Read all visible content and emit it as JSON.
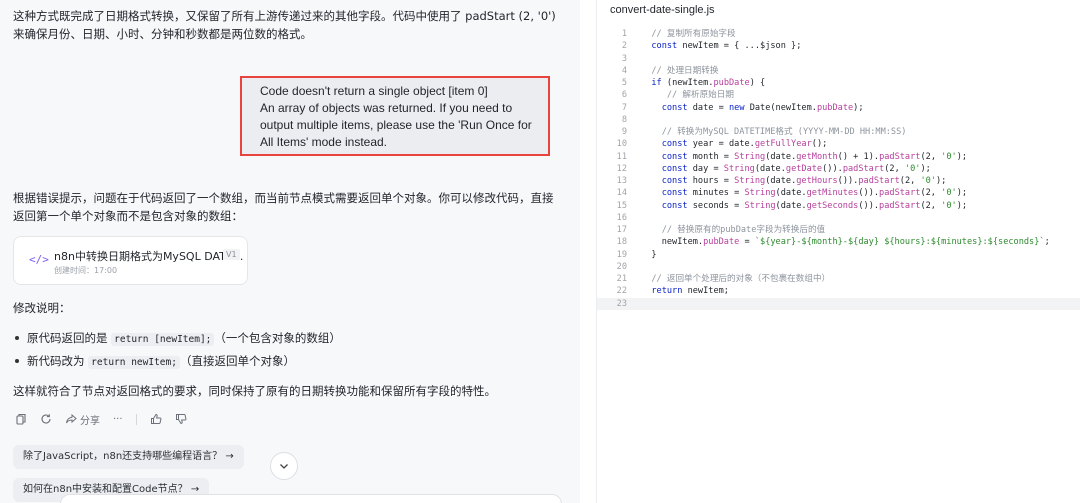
{
  "chat": {
    "intro_text": "这种方式既完成了日期格式转换，又保留了所有上游传递过来的其他字段。代码中使用了 padStart (2, '0') 来确保月份、日期、小时、分钟和秒数都是两位数的格式。",
    "user_message": {
      "line1": "Code doesn't return a single object [item 0]",
      "line2": "An array of objects was returned. If you need to",
      "line3": "output multiple items, please use the 'Run Once for",
      "line4": "All Items' mode instead."
    },
    "answer_text": "根据错误提示，问题在于代码返回了一个数组，而当前节点模式需要返回单个对象。你可以修改代码，直接返回第一个单个对象而不是包含对象的数组：",
    "artifact_card": {
      "icon": "code-icon",
      "title": "n8n中转换日期格式为MySQL DATE...",
      "version": "V1",
      "created": "创建时间：17:00"
    },
    "changes_heading": "修改说明：",
    "bullet1": {
      "prefix": "原代码返回的是 ",
      "code": "return [newItem];",
      "suffix": "（一个包含对象的数组）"
    },
    "bullet2": {
      "prefix": "新代码改为 ",
      "code": "return newItem;",
      "suffix": "（直接返回单个对象）"
    },
    "summary_text": "这样就符合了节点对返回格式的要求，同时保持了原有的日期转换功能和保留所有字段的特性。",
    "actions": {
      "share_label": "分享",
      "more_label": "···"
    },
    "suggestions": [
      "除了JavaScript，n8n还支持哪些编程语言？ →",
      "如何在n8n中安装和配置Code节点？ →"
    ]
  },
  "editor": {
    "filename": "convert-date-single.js",
    "active_line": 23,
    "lines": [
      {
        "n": "1",
        "tokens": [
          {
            "t": "  // 复制所有原始字段",
            "c": "com"
          }
        ]
      },
      {
        "n": "2",
        "tokens": [
          {
            "t": "  ",
            "c": "pl"
          },
          {
            "t": "const",
            "c": "kw"
          },
          {
            "t": " newItem = { ...$json };",
            "c": "pl"
          }
        ]
      },
      {
        "n": "3",
        "tokens": []
      },
      {
        "n": "4",
        "tokens": [
          {
            "t": "  // 处理日期转换",
            "c": "com"
          }
        ]
      },
      {
        "n": "5",
        "tokens": [
          {
            "t": "  ",
            "c": "pl"
          },
          {
            "t": "if",
            "c": "kw"
          },
          {
            "t": " (newItem.",
            "c": "pl"
          },
          {
            "t": "pubDate",
            "c": "fn"
          },
          {
            "t": ") {",
            "c": "pl"
          }
        ]
      },
      {
        "n": "6",
        "tokens": [
          {
            "t": "     // 解析原始日期",
            "c": "com"
          }
        ]
      },
      {
        "n": "7",
        "tokens": [
          {
            "t": "    ",
            "c": "pl"
          },
          {
            "t": "const",
            "c": "kw"
          },
          {
            "t": " date = ",
            "c": "pl"
          },
          {
            "t": "new",
            "c": "kw"
          },
          {
            "t": " Date(newItem.",
            "c": "pl"
          },
          {
            "t": "pubDate",
            "c": "fn"
          },
          {
            "t": ");",
            "c": "pl"
          }
        ]
      },
      {
        "n": "8",
        "tokens": []
      },
      {
        "n": "9",
        "tokens": [
          {
            "t": "    // 转换为MySQL DATETIME格式 (YYYY-MM-DD HH:MM:SS)",
            "c": "com"
          }
        ]
      },
      {
        "n": "10",
        "tokens": [
          {
            "t": "    ",
            "c": "pl"
          },
          {
            "t": "const",
            "c": "kw"
          },
          {
            "t": " year = date.",
            "c": "pl"
          },
          {
            "t": "getFullYear",
            "c": "fn"
          },
          {
            "t": "();",
            "c": "pl"
          }
        ]
      },
      {
        "n": "11",
        "tokens": [
          {
            "t": "    ",
            "c": "pl"
          },
          {
            "t": "const",
            "c": "kw"
          },
          {
            "t": " month = ",
            "c": "pl"
          },
          {
            "t": "String",
            "c": "fn"
          },
          {
            "t": "(date.",
            "c": "pl"
          },
          {
            "t": "getMonth",
            "c": "fn"
          },
          {
            "t": "() + 1).",
            "c": "pl"
          },
          {
            "t": "padStart",
            "c": "fn"
          },
          {
            "t": "(2, ",
            "c": "pl"
          },
          {
            "t": "'0'",
            "c": "str"
          },
          {
            "t": ");",
            "c": "pl"
          }
        ]
      },
      {
        "n": "12",
        "tokens": [
          {
            "t": "    ",
            "c": "pl"
          },
          {
            "t": "const",
            "c": "kw"
          },
          {
            "t": " day = ",
            "c": "pl"
          },
          {
            "t": "String",
            "c": "fn"
          },
          {
            "t": "(date.",
            "c": "pl"
          },
          {
            "t": "getDate",
            "c": "fn"
          },
          {
            "t": "()).",
            "c": "pl"
          },
          {
            "t": "padStart",
            "c": "fn"
          },
          {
            "t": "(2, ",
            "c": "pl"
          },
          {
            "t": "'0'",
            "c": "str"
          },
          {
            "t": ");",
            "c": "pl"
          }
        ]
      },
      {
        "n": "13",
        "tokens": [
          {
            "t": "    ",
            "c": "pl"
          },
          {
            "t": "const",
            "c": "kw"
          },
          {
            "t": " hours = ",
            "c": "pl"
          },
          {
            "t": "String",
            "c": "fn"
          },
          {
            "t": "(date.",
            "c": "pl"
          },
          {
            "t": "getHours",
            "c": "fn"
          },
          {
            "t": "()).",
            "c": "pl"
          },
          {
            "t": "padStart",
            "c": "fn"
          },
          {
            "t": "(2, ",
            "c": "pl"
          },
          {
            "t": "'0'",
            "c": "str"
          },
          {
            "t": ");",
            "c": "pl"
          }
        ]
      },
      {
        "n": "14",
        "tokens": [
          {
            "t": "    ",
            "c": "pl"
          },
          {
            "t": "const",
            "c": "kw"
          },
          {
            "t": " minutes = ",
            "c": "pl"
          },
          {
            "t": "String",
            "c": "fn"
          },
          {
            "t": "(date.",
            "c": "pl"
          },
          {
            "t": "getMinutes",
            "c": "fn"
          },
          {
            "t": "()).",
            "c": "pl"
          },
          {
            "t": "padStart",
            "c": "fn"
          },
          {
            "t": "(2, ",
            "c": "pl"
          },
          {
            "t": "'0'",
            "c": "str"
          },
          {
            "t": ");",
            "c": "pl"
          }
        ]
      },
      {
        "n": "15",
        "tokens": [
          {
            "t": "    ",
            "c": "pl"
          },
          {
            "t": "const",
            "c": "kw"
          },
          {
            "t": " seconds = ",
            "c": "pl"
          },
          {
            "t": "String",
            "c": "fn"
          },
          {
            "t": "(date.",
            "c": "pl"
          },
          {
            "t": "getSeconds",
            "c": "fn"
          },
          {
            "t": "()).",
            "c": "pl"
          },
          {
            "t": "padStart",
            "c": "fn"
          },
          {
            "t": "(2, ",
            "c": "pl"
          },
          {
            "t": "'0'",
            "c": "str"
          },
          {
            "t": ");",
            "c": "pl"
          }
        ]
      },
      {
        "n": "16",
        "tokens": []
      },
      {
        "n": "17",
        "tokens": [
          {
            "t": "    // 替换原有的pubDate字段为转换后的值",
            "c": "com"
          }
        ]
      },
      {
        "n": "18",
        "tokens": [
          {
            "t": "    newItem.",
            "c": "pl"
          },
          {
            "t": "pubDate",
            "c": "fn"
          },
          {
            "t": " = ",
            "c": "pl"
          },
          {
            "t": "`${year}-${month}-${day} ${hours}:${minutes}:${seconds}`",
            "c": "str"
          },
          {
            "t": ";",
            "c": "pl"
          }
        ]
      },
      {
        "n": "19",
        "tokens": [
          {
            "t": "  }",
            "c": "pl"
          }
        ]
      },
      {
        "n": "20",
        "tokens": []
      },
      {
        "n": "21",
        "tokens": [
          {
            "t": "  // 返回单个处理后的对象（不包裹在数组中）",
            "c": "com"
          }
        ]
      },
      {
        "n": "22",
        "tokens": [
          {
            "t": "  ",
            "c": "pl"
          },
          {
            "t": "return",
            "c": "kw"
          },
          {
            "t": " newItem;",
            "c": "pl"
          }
        ]
      },
      {
        "n": "23",
        "tokens": []
      }
    ]
  }
}
